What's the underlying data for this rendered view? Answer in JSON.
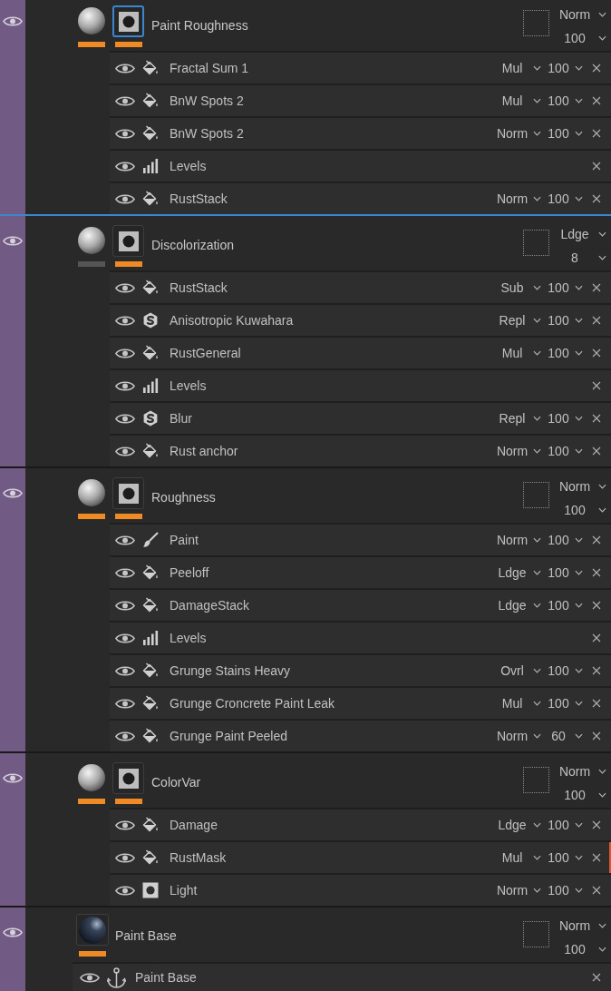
{
  "layers": [
    {
      "name": "Paint Roughness",
      "kind": "fill",
      "selected": true,
      "material_on": true,
      "mask": {
        "selected": true,
        "on": true
      },
      "blend": "Norm",
      "opacity": "100",
      "effects": [
        {
          "kind": "fill",
          "name": "Fractal Sum 1",
          "blend": "Mul",
          "opacity": "100",
          "flagged": false
        },
        {
          "kind": "fill",
          "name": "BnW Spots 2",
          "blend": "Mul",
          "opacity": "100",
          "flagged": false
        },
        {
          "kind": "fill",
          "name": "BnW Spots 2",
          "blend": "Norm",
          "opacity": "100",
          "flagged": false
        },
        {
          "kind": "levels",
          "name": "Levels",
          "flagged": false
        },
        {
          "kind": "fill",
          "name": "RustStack",
          "blend": "Norm",
          "opacity": "100",
          "flagged": false
        }
      ]
    },
    {
      "name": "Discolorization",
      "kind": "fill",
      "selected": false,
      "material_on": false,
      "mask": {
        "selected": false,
        "on": true
      },
      "blend": "Ldge",
      "opacity": "8",
      "effects": [
        {
          "kind": "fill",
          "name": "RustStack",
          "blend": "Sub",
          "opacity": "100",
          "flagged": false
        },
        {
          "kind": "filter",
          "name": "Anisotropic Kuwahara",
          "blend": "Repl",
          "opacity": "100",
          "flagged": false
        },
        {
          "kind": "fill",
          "name": "RustGeneral",
          "blend": "Mul",
          "opacity": "100",
          "flagged": false
        },
        {
          "kind": "levels",
          "name": "Levels",
          "flagged": false
        },
        {
          "kind": "filter",
          "name": "Blur",
          "blend": "Repl",
          "opacity": "100",
          "flagged": false
        },
        {
          "kind": "fill",
          "name": "Rust anchor",
          "blend": "Norm",
          "opacity": "100",
          "flagged": false
        }
      ]
    },
    {
      "name": "Roughness",
      "kind": "fill",
      "selected": false,
      "material_on": true,
      "mask": {
        "selected": false,
        "on": true
      },
      "blend": "Norm",
      "opacity": "100",
      "effects": [
        {
          "kind": "paint",
          "name": "Paint",
          "blend": "Norm",
          "opacity": "100",
          "flagged": false
        },
        {
          "kind": "fill",
          "name": "Peeloff",
          "blend": "Ldge",
          "opacity": "100",
          "flagged": false
        },
        {
          "kind": "fill",
          "name": "DamageStack",
          "blend": "Ldge",
          "opacity": "100",
          "flagged": false
        },
        {
          "kind": "levels",
          "name": "Levels",
          "flagged": false
        },
        {
          "kind": "fill",
          "name": "Grunge Stains Heavy",
          "blend": "Ovrl",
          "opacity": "100",
          "flagged": false
        },
        {
          "kind": "fill",
          "name": "Grunge Croncrete Paint Leak",
          "blend": "Mul",
          "opacity": "100",
          "flagged": false
        },
        {
          "kind": "fill",
          "name": "Grunge Paint Peeled",
          "blend": "Norm",
          "opacity": "60",
          "flagged": false
        }
      ]
    },
    {
      "name": "ColorVar",
      "kind": "fill",
      "selected": false,
      "material_on": true,
      "mask": {
        "selected": false,
        "on": true
      },
      "blend": "Norm",
      "opacity": "100",
      "effects": [
        {
          "kind": "fill",
          "name": "Damage",
          "blend": "Ldge",
          "opacity": "100",
          "flagged": false
        },
        {
          "kind": "fill",
          "name": "RustMask",
          "blend": "Mul",
          "opacity": "100",
          "flagged": true
        },
        {
          "kind": "mask",
          "name": "Light",
          "blend": "Norm",
          "opacity": "100",
          "flagged": false
        }
      ]
    },
    {
      "name": "Paint Base",
      "kind": "paint",
      "selected": false,
      "material_on": true,
      "blend": "Norm",
      "opacity": "100",
      "effects": [
        {
          "kind": "anchor",
          "name": "Paint Base",
          "flagged": false
        }
      ]
    }
  ]
}
